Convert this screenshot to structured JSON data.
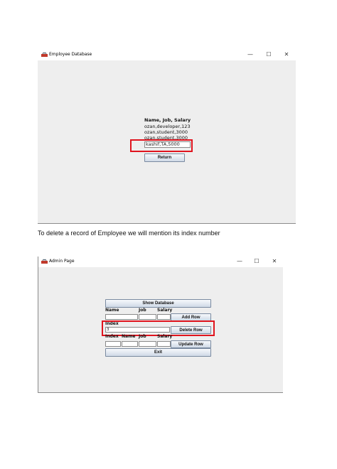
{
  "employee_window": {
    "title": "Employee Database",
    "controls": {
      "minimize": "—",
      "maximize": "☐",
      "close": "✕"
    },
    "header": "Name, Job, Salary",
    "records": [
      "ozan,developer,123",
      "ozan,student,3000",
      "ozan,student,3000"
    ],
    "input_value": "kashif,TA,5000",
    "return_label": "Return"
  },
  "caption": "To delete a record of Employee we will mention its index number",
  "admin_window": {
    "title": "Admin Page",
    "controls": {
      "minimize": "—",
      "maximize": "☐",
      "close": "✕"
    },
    "show_database_label": "Show Database",
    "add_section": {
      "name_label": "Name",
      "job_label": "Job",
      "salary_label": "Salary",
      "add_label": "Add Row"
    },
    "delete_section": {
      "index_label": "Index",
      "index_value": "3",
      "delete_label": "Delete Row"
    },
    "update_section": {
      "index_label": "Index",
      "name_label": "Name",
      "job_label": "Job",
      "salary_label": "Salary",
      "update_label": "Update Row"
    },
    "exit_label": "Exit"
  },
  "colors": {
    "highlight": "#e0141e",
    "window_bg": "#eeeeee"
  }
}
